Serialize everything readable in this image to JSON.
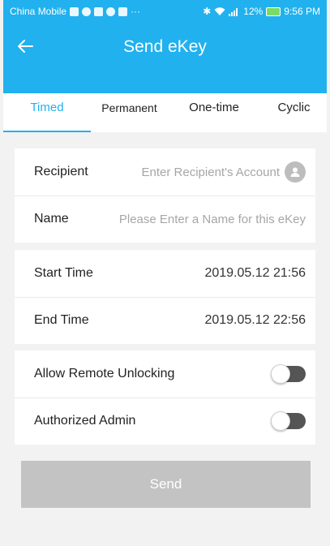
{
  "status_bar": {
    "carrier": "China Mobile",
    "battery_percent": "12%",
    "time": "9:56 PM"
  },
  "header": {
    "title": "Send eKey",
    "background": "#21b1ee"
  },
  "tabs": [
    {
      "label": "Timed",
      "active": true
    },
    {
      "label": "Permanent",
      "active": false
    },
    {
      "label": "One-time",
      "active": false
    },
    {
      "label": "Cyclic",
      "active": false
    }
  ],
  "recipient": {
    "label": "Recipient",
    "placeholder": "Enter Recipient's Account",
    "value": ""
  },
  "name": {
    "label": "Name",
    "placeholder": "Please Enter a Name for this eKey",
    "value": ""
  },
  "start_time": {
    "label": "Start Time",
    "value": "2019.05.12 21:56"
  },
  "end_time": {
    "label": "End Time",
    "value": "2019.05.12 22:56"
  },
  "allow_remote_unlocking": {
    "label": "Allow Remote Unlocking",
    "enabled": false
  },
  "authorized_admin": {
    "label": "Authorized Admin",
    "enabled": false
  },
  "send_button": {
    "label": "Send",
    "disabled": true
  },
  "colors": {
    "accent": "#21b1ee",
    "button_disabled": "#c3c3c3",
    "toggle_off": "#555555"
  },
  "icons": [
    "back-arrow-icon",
    "contact-icon",
    "wifi-icon",
    "signal-icon",
    "battery-icon",
    "bluetooth-icon"
  ]
}
